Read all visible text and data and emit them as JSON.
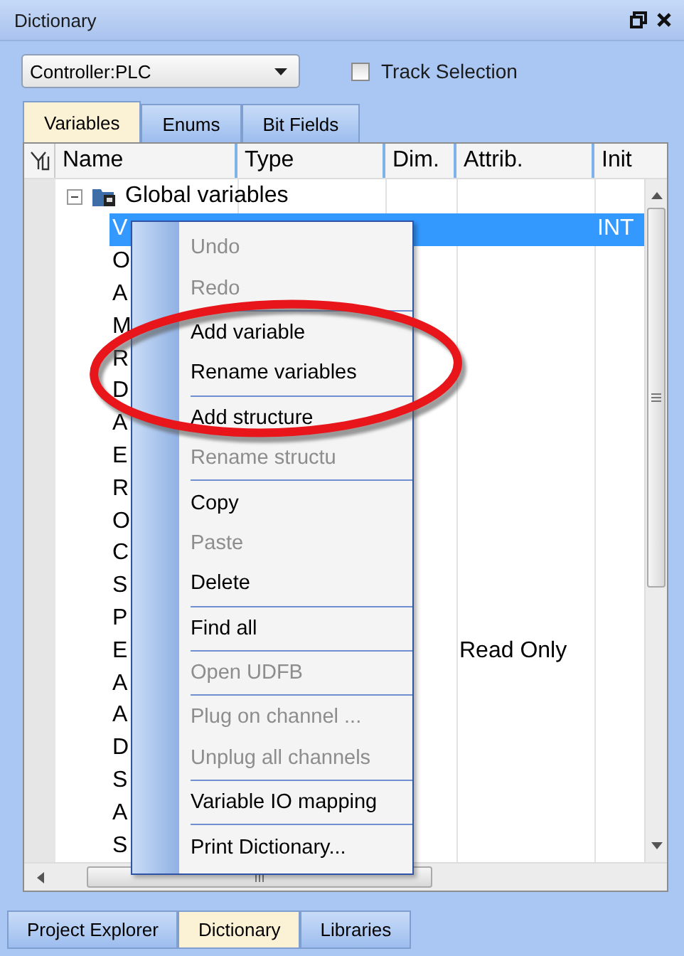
{
  "window": {
    "title": "Dictionary"
  },
  "controller_dropdown": {
    "value": "Controller:PLC"
  },
  "track_selection": {
    "label": "Track Selection",
    "checked": false
  },
  "tabs": [
    {
      "label": "Variables",
      "selected": true
    },
    {
      "label": "Enums",
      "selected": false
    },
    {
      "label": "Bit Fields",
      "selected": false
    }
  ],
  "table": {
    "columns": [
      "Name",
      "Type",
      "Dim.",
      "Attrib.",
      "Init"
    ],
    "tree": [
      {
        "label": "Global variables",
        "expanded": true,
        "children": [
          {
            "name": "V",
            "init": "INT",
            "selected": true
          },
          {
            "name": "O",
            "selected": false
          },
          {
            "name": "A",
            "selected": false
          },
          {
            "name": "M",
            "selected": false
          },
          {
            "name": "R",
            "selected": false
          },
          {
            "name": "D",
            "selected": false
          },
          {
            "name": "A",
            "selected": false
          },
          {
            "name": "E",
            "selected": false
          },
          {
            "name": "R",
            "selected": false
          },
          {
            "name": "O",
            "selected": false
          },
          {
            "name": "C",
            "selected": false
          },
          {
            "name": "S",
            "selected": false
          },
          {
            "name": "P",
            "selected": false
          },
          {
            "name": "E",
            "attrib": "Read Only",
            "selected": false
          },
          {
            "name": "A",
            "selected": false
          },
          {
            "name": "A",
            "selected": false
          },
          {
            "name": "D",
            "selected": false
          },
          {
            "name": "S",
            "selected": false
          },
          {
            "name": "A",
            "selected": false
          },
          {
            "name": "S",
            "selected": false
          }
        ]
      }
    ]
  },
  "context_menu": [
    {
      "kind": "item",
      "label": "Undo",
      "disabled": true
    },
    {
      "kind": "item",
      "label": "Redo",
      "disabled": true
    },
    {
      "kind": "separator"
    },
    {
      "kind": "item",
      "label": "Add variable",
      "disabled": false
    },
    {
      "kind": "item",
      "label": "Rename variables",
      "disabled": false
    },
    {
      "kind": "separator"
    },
    {
      "kind": "item",
      "label": "Add structure",
      "disabled": false
    },
    {
      "kind": "item",
      "label": "Rename structu",
      "disabled": true
    },
    {
      "kind": "separator"
    },
    {
      "kind": "item",
      "label": "Copy",
      "disabled": false
    },
    {
      "kind": "item",
      "label": "Paste",
      "disabled": true
    },
    {
      "kind": "item",
      "label": "Delete",
      "disabled": false
    },
    {
      "kind": "separator"
    },
    {
      "kind": "item",
      "label": "Find all",
      "disabled": false
    },
    {
      "kind": "separator"
    },
    {
      "kind": "item",
      "label": "Open UDFB",
      "disabled": true
    },
    {
      "kind": "separator"
    },
    {
      "kind": "item",
      "label": "Plug on channel ...",
      "disabled": true
    },
    {
      "kind": "item",
      "label": "Unplug all channels",
      "disabled": true
    },
    {
      "kind": "separator"
    },
    {
      "kind": "item",
      "label": "Variable IO mapping",
      "disabled": false
    },
    {
      "kind": "separator"
    },
    {
      "kind": "item",
      "label": "Print Dictionary...",
      "disabled": false
    }
  ],
  "bottom_tabs": [
    {
      "label": "Project Explorer",
      "selected": false
    },
    {
      "label": "Dictionary",
      "selected": true
    },
    {
      "label": "Libraries",
      "selected": false
    }
  ]
}
